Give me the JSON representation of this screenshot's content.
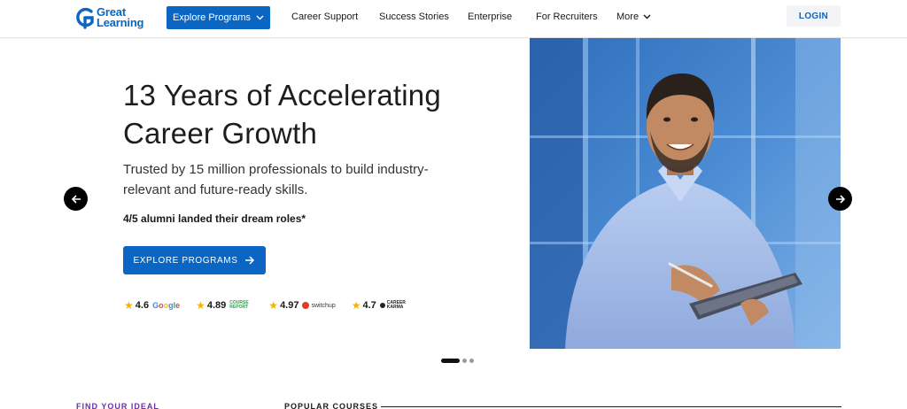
{
  "brand": {
    "line1": "Great",
    "line2": "Learning",
    "color": "#0a66c2"
  },
  "nav": {
    "explore_label": "Explore Programs",
    "links": [
      "Career Support",
      "Success Stories",
      "Enterprise",
      "For Recruiters",
      "More"
    ],
    "login_label": "LOGIN"
  },
  "hero": {
    "title_line1": "13 Years of Accelerating",
    "title_line2": "Career Growth",
    "subtitle_line1": "Trusted by 15 million professionals to build industry-",
    "subtitle_line2": "relevant and future-ready skills.",
    "alumni_text": "4/5 alumni landed their dream roles*",
    "cta_label": "EXPLORE PROGRAMS"
  },
  "ratings": [
    {
      "value": "4.6",
      "source": "Google"
    },
    {
      "value": "4.89",
      "source": "COURSE REPORT"
    },
    {
      "value": "4.97",
      "source": "switchup"
    },
    {
      "value": "4.7",
      "source": "CAREER KARMA"
    }
  ],
  "carousel": {
    "slides": 3,
    "active": 1
  },
  "sections": {
    "find_label": "FIND YOUR IDEAL",
    "popular_label": "POPULAR COURSES"
  },
  "colors": {
    "accent": "#0a66c2",
    "star": "#f5b301",
    "find_label": "#6b2fa0"
  }
}
